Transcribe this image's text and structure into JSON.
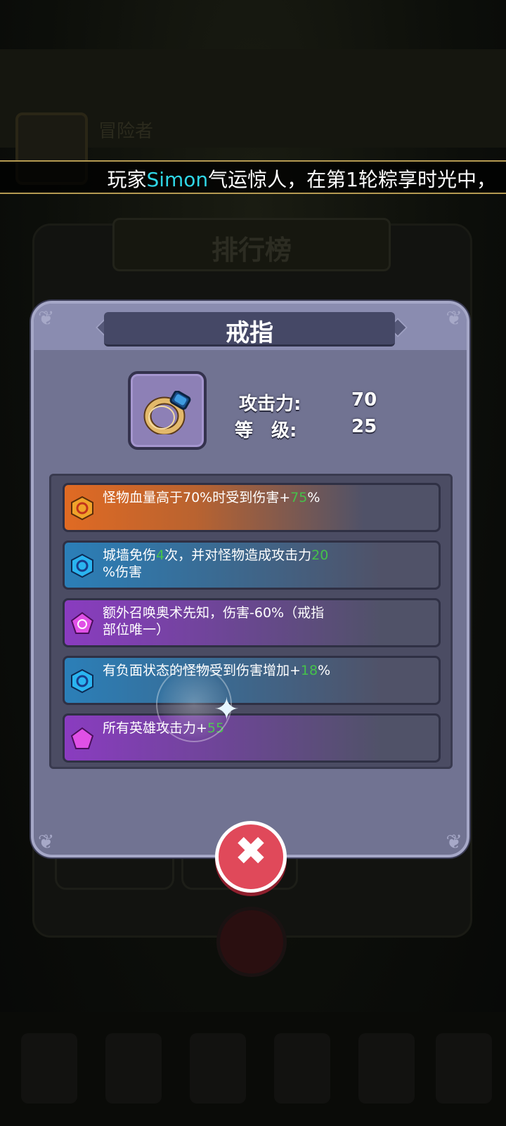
{
  "background": {
    "player_label": "冒险者",
    "rank_title": "排行榜"
  },
  "marquee": {
    "prefix": "玩家",
    "player": "Simon",
    "suffix": "气运惊人，在第1轮粽享时光中，"
  },
  "modal": {
    "title": "戒指",
    "item_icon": "ring-icon",
    "stats": [
      {
        "label": "攻击力:",
        "value": "70"
      },
      {
        "label": "等　级:",
        "value": "25"
      }
    ],
    "affixes": [
      {
        "gem": "orange-hexagon-gem",
        "text_a": "怪物血量高于70%时受到伤害+",
        "num": "75",
        "text_b": "%",
        "color": "#e06a23"
      },
      {
        "gem": "blue-hexagon-gem",
        "text_a": "城墙免伤",
        "num": "4",
        "text_b": "次，并对怪物造成攻击力",
        "num2": "20",
        "text_c": "%伤害",
        "color": "#2b7fb8"
      },
      {
        "gem": "purple-pentagon-gem",
        "text_a": "额外召唤奥术先知，伤害-60%（戒指部位唯一）",
        "color": "#8a3cc0"
      },
      {
        "gem": "blue-hexagon-gem",
        "text_a": "有负面状态的怪物受到伤害增加+",
        "num": "18",
        "text_b": "%",
        "color": "#2b7fb8"
      },
      {
        "gem": "purple-pentagon-gem",
        "text_a": "所有英雄攻击力+",
        "num": "55",
        "text_b": "",
        "color": "#8a3cc0"
      }
    ]
  },
  "close_button": {
    "icon": "close-icon",
    "label": "✖"
  }
}
